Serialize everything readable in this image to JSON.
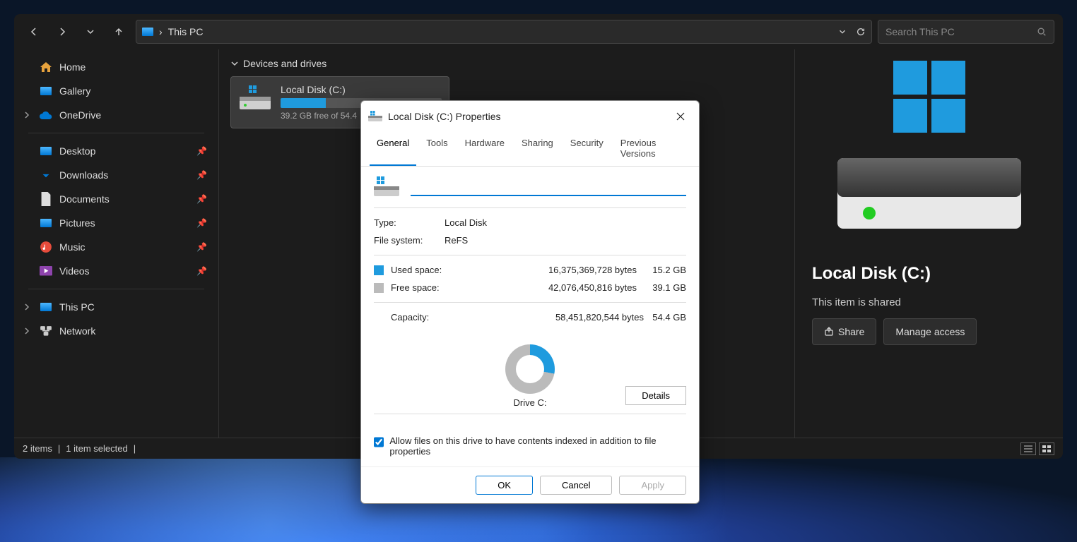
{
  "explorer": {
    "breadcrumb": "This PC",
    "search_placeholder": "Search This PC",
    "sidebar": {
      "home": "Home",
      "gallery": "Gallery",
      "onedrive": "OneDrive",
      "desktop": "Desktop",
      "downloads": "Downloads",
      "documents": "Documents",
      "pictures": "Pictures",
      "music": "Music",
      "videos": "Videos",
      "thispc": "This PC",
      "network": "Network"
    },
    "section_header": "Devices and drives",
    "drive": {
      "name": "Local Disk (C:)",
      "free_text": "39.2 GB free of 54.4"
    },
    "status": {
      "items": "2 items",
      "selected": "1 item selected"
    },
    "details": {
      "name": "Local Disk (C:)",
      "shared": "This item is shared",
      "share_btn": "Share",
      "manage_btn": "Manage access"
    }
  },
  "dialog": {
    "title": "Local Disk (C:) Properties",
    "tabs": [
      "General",
      "Tools",
      "Hardware",
      "Sharing",
      "Security",
      "Previous Versions"
    ],
    "name_value": "",
    "type_label": "Type:",
    "type_value": "Local Disk",
    "fs_label": "File system:",
    "fs_value": "ReFS",
    "used_label": "Used space:",
    "used_bytes": "16,375,369,728 bytes",
    "used_gb": "15.2 GB",
    "free_label": "Free space:",
    "free_bytes": "42,076,450,816 bytes",
    "free_gb": "39.1 GB",
    "cap_label": "Capacity:",
    "cap_bytes": "58,451,820,544 bytes",
    "cap_gb": "54.4 GB",
    "drive_label": "Drive C:",
    "details_btn": "Details",
    "index_checkbox": "Allow files on this drive to have contents indexed in addition to file properties",
    "ok": "OK",
    "cancel": "Cancel",
    "apply": "Apply"
  },
  "chart_data": {
    "type": "pie",
    "title": "Drive C:",
    "categories": [
      "Used space",
      "Free space"
    ],
    "values": [
      15.2,
      39.1
    ],
    "unit": "GB",
    "total": 54.4,
    "colors": [
      "#1f9bde",
      "#bbbbbb"
    ]
  }
}
